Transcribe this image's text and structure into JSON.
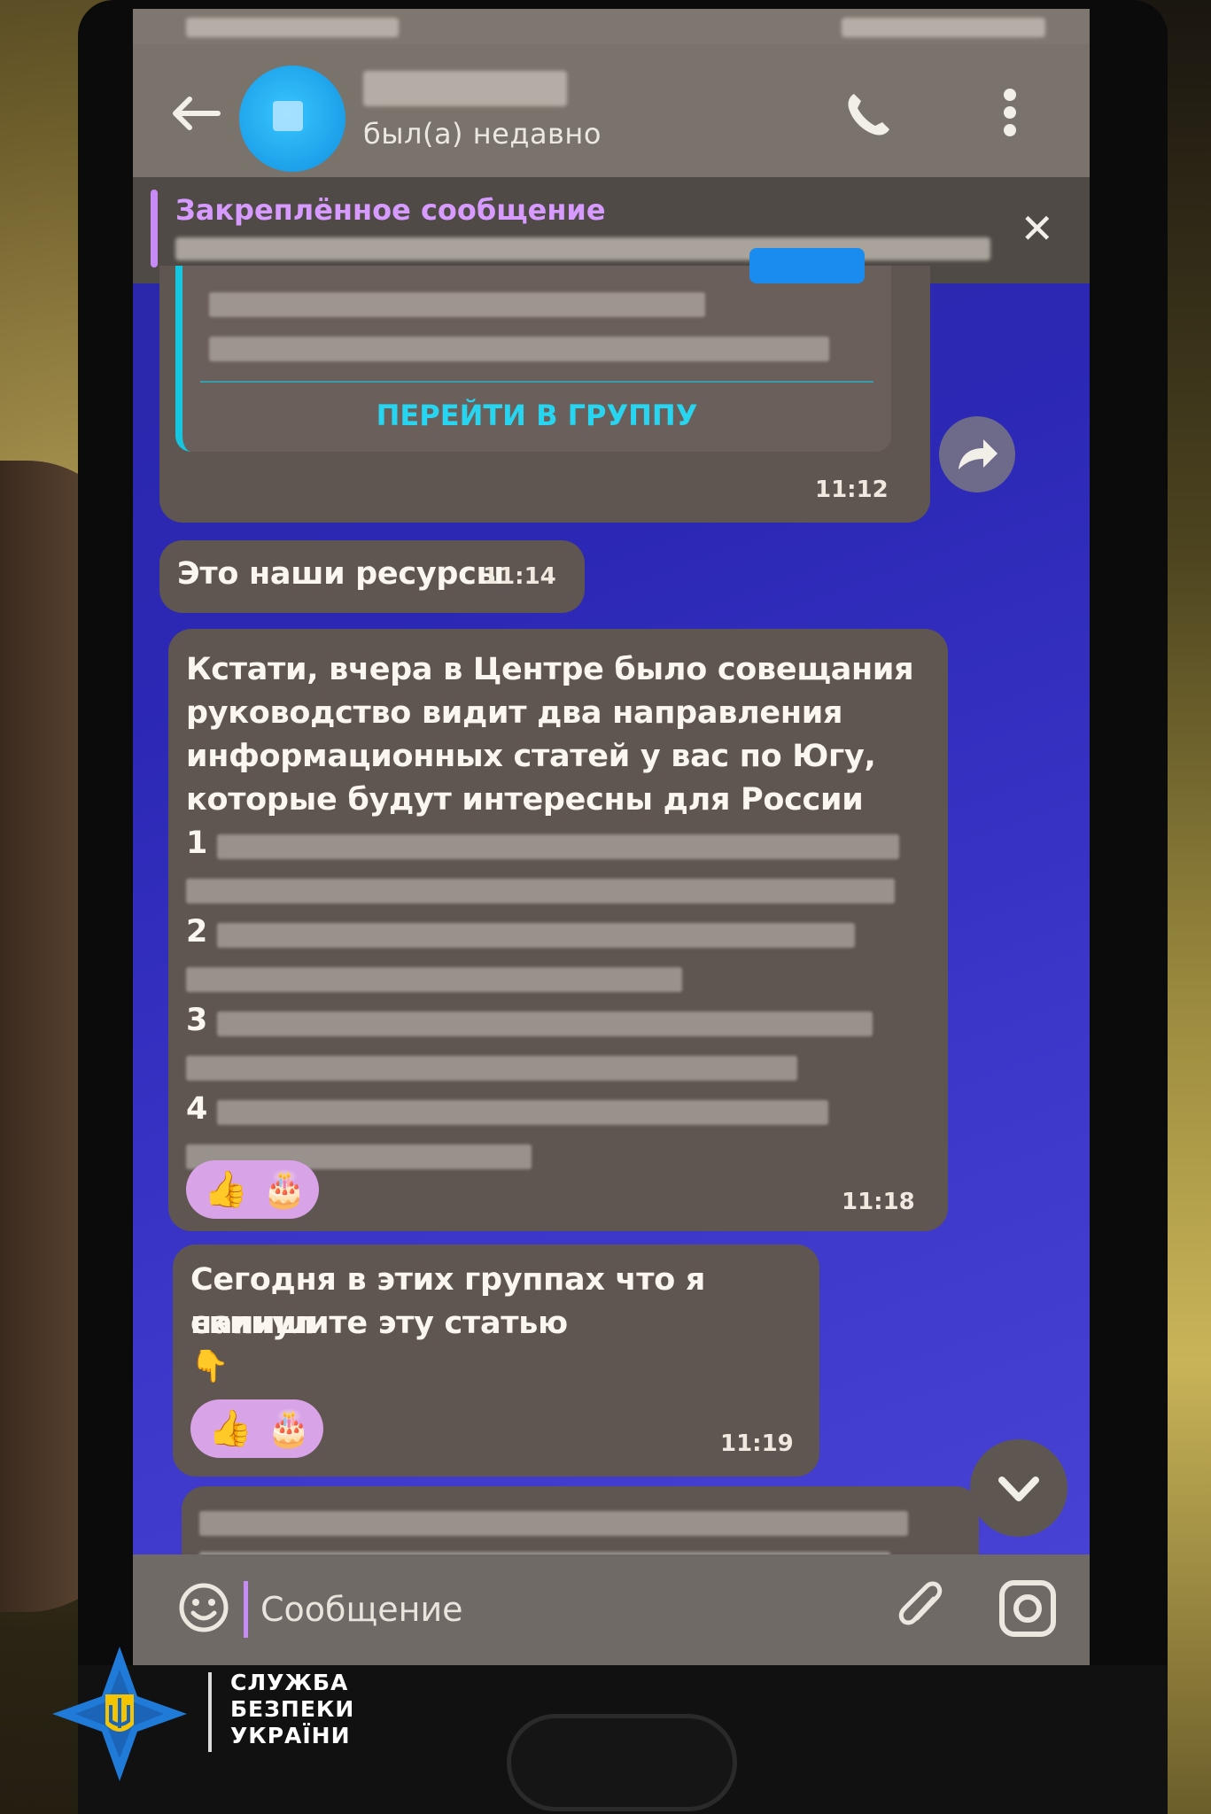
{
  "header": {
    "contact_status": "был(а) недавно"
  },
  "pinned": {
    "title": "Закреплённое сообщение",
    "close_glyph": "✕"
  },
  "messages": {
    "link_card": {
      "button_label": "ПЕРЕЙТИ В ГРУППУ",
      "time": "11:12"
    },
    "msg1": {
      "text": "Это наши ресурсы",
      "time": "11:14"
    },
    "msg2": {
      "lines": [
        "Кстати, вчера в Центре было совещания",
        "руководство видит два направления",
        "информационных статей у вас по Югу,",
        "которые будут интересны для России"
      ],
      "items": [
        "1",
        "2",
        "3",
        "4"
      ],
      "time": "11:18"
    },
    "msg3": {
      "lines": [
        "Сегодня в этих группах что я скинул",
        "напишите эту статью"
      ],
      "emoji": "👇",
      "time": "11:19"
    }
  },
  "input": {
    "placeholder": "Сообщение"
  },
  "watermark": {
    "line1": "СЛУЖБА",
    "line2": "БЕЗПЕКИ",
    "line3": "УКРАЇНИ"
  },
  "icons": {
    "back": "back-arrow-icon",
    "call": "phone-icon",
    "menu": "vertical-dots-icon",
    "forward": "forward-arrow-icon",
    "scroll": "chevron-down-icon",
    "emoji": "smiley-icon",
    "attach": "paperclip-icon",
    "camera": "camera-icon",
    "reaction_thumb": "👍",
    "reaction_cake": "🎂"
  },
  "colors": {
    "chat_bg": "#2c28b5",
    "accent_pinned": "#d79bff",
    "link_accent": "#28d5f0",
    "bubble": "#5f5651"
  }
}
